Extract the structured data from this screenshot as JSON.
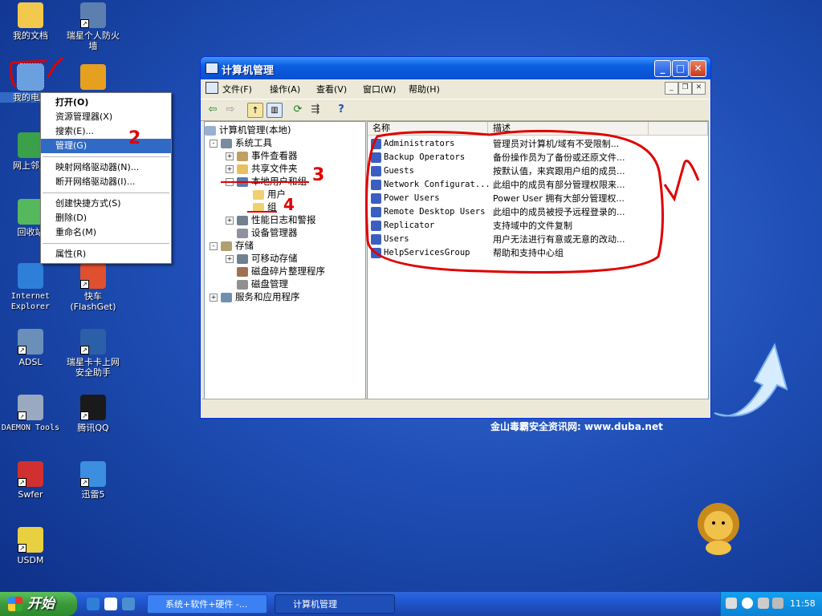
{
  "desktop": {
    "icons": [
      {
        "label": "我的文档",
        "color": "#f2c94c",
        "shortcut": false
      },
      {
        "label": "瑞星个人防火墙",
        "color": "#5d7fb0",
        "shortcut": true
      },
      {
        "label": "我的电脑",
        "color": "#6aa0e0",
        "shortcut": false
      },
      {
        "label": "",
        "color": "#e6a020",
        "shortcut": false
      },
      {
        "label": "网上邻居",
        "color": "#3aa04a",
        "shortcut": false
      },
      {
        "label": "回收站",
        "color": "#56b85c",
        "shortcut": false
      },
      {
        "label": "Internet Explorer",
        "color": "#2e7fd8",
        "shortcut": false
      },
      {
        "label": "快车(FlashGet)",
        "color": "#e05030",
        "shortcut": true
      },
      {
        "label": "ADSL",
        "color": "#6a8fb8",
        "shortcut": true
      },
      {
        "label": "瑞星卡卡上网安全助手",
        "color": "#2b5fa8",
        "shortcut": true
      },
      {
        "label": "DAEMON Tools",
        "color": "#9aa8c0",
        "shortcut": true
      },
      {
        "label": "腾讯QQ",
        "color": "#1a1a1a",
        "shortcut": true
      },
      {
        "label": "Swfer",
        "color": "#d03030",
        "shortcut": true
      },
      {
        "label": "迅雷5",
        "color": "#3c8ee0",
        "shortcut": true
      },
      {
        "label": "USDM",
        "color": "#e8d040",
        "shortcut": true
      }
    ],
    "watermark": "金山毒霸安全资讯网: www.duba.net"
  },
  "context_menu": {
    "items": [
      {
        "label": "打开(O)",
        "bold": true
      },
      {
        "label": "资源管理器(X)"
      },
      {
        "label": "搜索(E)..."
      },
      {
        "label": "管理(G)",
        "selected": true
      },
      {
        "label": "映射网络驱动器(N)..."
      },
      {
        "label": "断开网络驱动器(I)..."
      },
      {
        "label": "创建快捷方式(S)"
      },
      {
        "label": "删除(D)"
      },
      {
        "label": "重命名(M)"
      },
      {
        "label": "属性(R)"
      }
    ]
  },
  "window": {
    "title": "计算机管理",
    "menus": [
      "文件(F)",
      "操作(A)",
      "查看(V)",
      "窗口(W)",
      "帮助(H)"
    ],
    "tree": [
      {
        "label": "计算机管理(本地)",
        "level": 0,
        "toggle": ""
      },
      {
        "label": "系统工具",
        "level": 1,
        "toggle": "-"
      },
      {
        "label": "事件查看器",
        "level": 2,
        "toggle": "+"
      },
      {
        "label": "共享文件夹",
        "level": 2,
        "toggle": "+"
      },
      {
        "label": "本地用户和组",
        "level": 2,
        "toggle": "-"
      },
      {
        "label": "用户",
        "level": 3,
        "toggle": ""
      },
      {
        "label": "组",
        "level": 3,
        "toggle": ""
      },
      {
        "label": "性能日志和警报",
        "level": 2,
        "toggle": "+"
      },
      {
        "label": "设备管理器",
        "level": 2,
        "toggle": ""
      },
      {
        "label": "存储",
        "level": 1,
        "toggle": "-"
      },
      {
        "label": "可移动存储",
        "level": 2,
        "toggle": "+"
      },
      {
        "label": "磁盘碎片整理程序",
        "level": 2,
        "toggle": ""
      },
      {
        "label": "磁盘管理",
        "level": 2,
        "toggle": ""
      },
      {
        "label": "服务和应用程序",
        "level": 1,
        "toggle": "+"
      }
    ],
    "columns": [
      "名称",
      "描述"
    ],
    "groups": [
      {
        "name": "Administrators",
        "desc": "管理员对计算机/域有不受限制..."
      },
      {
        "name": "Backup Operators",
        "desc": "备份操作员为了备份或还原文件..."
      },
      {
        "name": "Guests",
        "desc": "按默认值，来宾跟用户组的成员..."
      },
      {
        "name": "Network Configurat...",
        "desc": "此组中的成员有部分管理权限来..."
      },
      {
        "name": "Power Users",
        "desc": "Power User 拥有大部分管理权..."
      },
      {
        "name": "Remote Desktop Users",
        "desc": "此组中的成员被授予远程登录的..."
      },
      {
        "name": "Replicator",
        "desc": "支持域中的文件复制"
      },
      {
        "name": "Users",
        "desc": "用户无法进行有意或无意的改动..."
      },
      {
        "name": "HelpServicesGroup",
        "desc": "帮助和支持中心组"
      }
    ]
  },
  "annotations": [
    "2",
    "3",
    "4"
  ],
  "taskbar": {
    "start_label": "开始",
    "tasks": [
      {
        "label": "系统+软件+硬件 -..."
      },
      {
        "label": "计算机管理",
        "active": true
      }
    ],
    "clock": "11:58"
  },
  "colors": {
    "selection": "#316ac5",
    "annotation": "#e00000",
    "titlebar": "#0a5ee0"
  }
}
